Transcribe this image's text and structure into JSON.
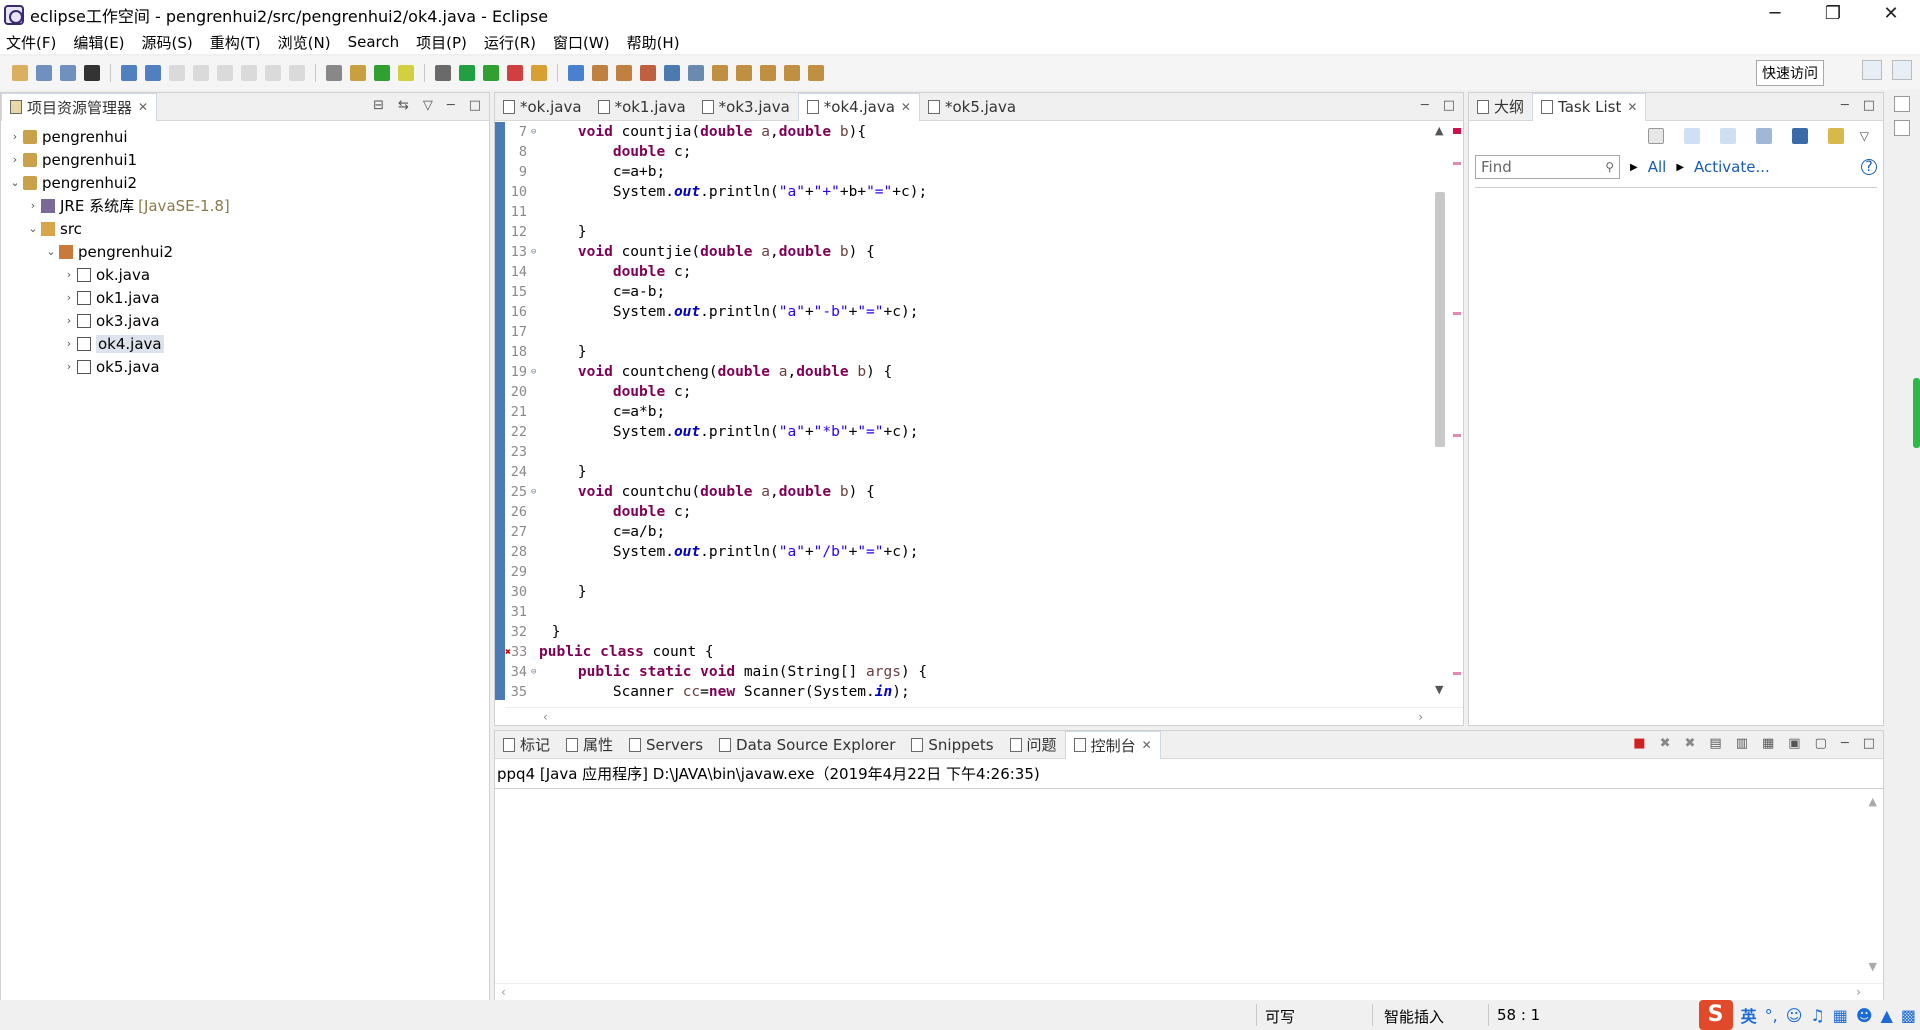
{
  "window": {
    "title": "eclipse工作空间 - pengrenhui2/src/pengrenhui2/ok4.java - Eclipse",
    "controls": [
      "─",
      "❐",
      "✕"
    ]
  },
  "menu": [
    "文件(F)",
    "编辑(E)",
    "源码(S)",
    "重构(T)",
    "浏览(N)",
    "Search",
    "项目(P)",
    "运行(R)",
    "窗口(W)",
    "帮助(H)"
  ],
  "toolbar": {
    "quick_access": "快速访问"
  },
  "explorer": {
    "title": "项目资源管理器",
    "items": [
      {
        "label": "pengrenhui",
        "level": 0,
        "expanded": false,
        "icon": "project-icon"
      },
      {
        "label": "pengrenhui1",
        "level": 0,
        "expanded": false,
        "icon": "project-icon"
      },
      {
        "label": "pengrenhui2",
        "level": 0,
        "expanded": true,
        "icon": "project-icon"
      },
      {
        "label": "JRE 系统库",
        "extra": "[JavaSE-1.8]",
        "level": 1,
        "expanded": false,
        "icon": "library-icon"
      },
      {
        "label": "src",
        "level": 1,
        "expanded": true,
        "icon": "source-folder-icon"
      },
      {
        "label": "pengrenhui2",
        "level": 2,
        "expanded": true,
        "icon": "package-icon"
      },
      {
        "label": "ok.java",
        "level": 3,
        "expanded": false,
        "icon": "java-file-icon"
      },
      {
        "label": "ok1.java",
        "level": 3,
        "expanded": false,
        "icon": "java-file-icon"
      },
      {
        "label": "ok3.java",
        "level": 3,
        "expanded": false,
        "icon": "java-file-icon"
      },
      {
        "label": "ok4.java",
        "level": 3,
        "expanded": false,
        "icon": "java-file-icon",
        "selected": true
      },
      {
        "label": "ok5.java",
        "level": 3,
        "expanded": false,
        "icon": "java-file-icon"
      }
    ]
  },
  "editor": {
    "tabs": [
      {
        "label": "*ok.java",
        "active": false
      },
      {
        "label": "*ok1.java",
        "active": false
      },
      {
        "label": "*ok3.java",
        "active": false
      },
      {
        "label": "*ok4.java",
        "active": true
      },
      {
        "label": "*ok5.java",
        "active": false
      }
    ],
    "lines": [
      {
        "n": "7",
        "fold": true,
        "code": [
          [
            "",
            "    "
          ],
          [
            "kw",
            "void"
          ],
          [
            "",
            " countjia("
          ],
          [
            "kw",
            "double"
          ],
          [
            "",
            " "
          ],
          [
            "prm",
            "a"
          ],
          [
            "",
            ","
          ],
          [
            "kw",
            "double"
          ],
          [
            "",
            " "
          ],
          [
            "prm",
            "b"
          ],
          [
            "",
            "){"
          ]
        ]
      },
      {
        "n": "8",
        "code": [
          [
            "",
            "        "
          ],
          [
            "kw",
            "double"
          ],
          [
            "",
            " c;"
          ]
        ]
      },
      {
        "n": "9",
        "code": [
          [
            "",
            "        c=a+b;"
          ]
        ]
      },
      {
        "n": "10",
        "code": [
          [
            "",
            "        System."
          ],
          [
            "fi",
            "out"
          ],
          [
            "",
            ".println("
          ],
          [
            "st",
            "\"a\""
          ],
          [
            "",
            "+"
          ],
          [
            "st",
            "\"+\""
          ],
          [
            "",
            "+b+"
          ],
          [
            "st",
            "\"=\""
          ],
          [
            "",
            "+c);"
          ]
        ]
      },
      {
        "n": "11",
        "code": [
          [
            "",
            ""
          ]
        ]
      },
      {
        "n": "12",
        "code": [
          [
            "",
            "    }"
          ]
        ]
      },
      {
        "n": "13",
        "fold": true,
        "code": [
          [
            "",
            "    "
          ],
          [
            "kw",
            "void"
          ],
          [
            "",
            " countjie("
          ],
          [
            "kw",
            "double"
          ],
          [
            "",
            " "
          ],
          [
            "prm",
            "a"
          ],
          [
            "",
            ","
          ],
          [
            "kw",
            "double"
          ],
          [
            "",
            " "
          ],
          [
            "prm",
            "b"
          ],
          [
            "",
            ") {"
          ]
        ]
      },
      {
        "n": "14",
        "code": [
          [
            "",
            "        "
          ],
          [
            "kw",
            "double"
          ],
          [
            "",
            " c;"
          ]
        ]
      },
      {
        "n": "15",
        "code": [
          [
            "",
            "        c=a-b;"
          ]
        ]
      },
      {
        "n": "16",
        "code": [
          [
            "",
            "        System."
          ],
          [
            "fi",
            "out"
          ],
          [
            "",
            ".println("
          ],
          [
            "st",
            "\"a\""
          ],
          [
            "",
            "+"
          ],
          [
            "st",
            "\"-b\""
          ],
          [
            "",
            "+"
          ],
          [
            "st",
            "\"=\""
          ],
          [
            "",
            "+c);"
          ]
        ]
      },
      {
        "n": "17",
        "code": [
          [
            "",
            ""
          ]
        ]
      },
      {
        "n": "18",
        "code": [
          [
            "",
            "    }"
          ]
        ]
      },
      {
        "n": "19",
        "fold": true,
        "code": [
          [
            "",
            "    "
          ],
          [
            "kw",
            "void"
          ],
          [
            "",
            " countcheng("
          ],
          [
            "kw",
            "double"
          ],
          [
            "",
            " "
          ],
          [
            "prm",
            "a"
          ],
          [
            "",
            ","
          ],
          [
            "kw",
            "double"
          ],
          [
            "",
            " "
          ],
          [
            "prm",
            "b"
          ],
          [
            "",
            ") {"
          ]
        ]
      },
      {
        "n": "20",
        "code": [
          [
            "",
            "        "
          ],
          [
            "kw",
            "double"
          ],
          [
            "",
            " c;"
          ]
        ]
      },
      {
        "n": "21",
        "code": [
          [
            "",
            "        c=a*b;"
          ]
        ]
      },
      {
        "n": "22",
        "code": [
          [
            "",
            "        System."
          ],
          [
            "fi",
            "out"
          ],
          [
            "",
            ".println("
          ],
          [
            "st",
            "\"a\""
          ],
          [
            "",
            "+"
          ],
          [
            "st",
            "\"*b\""
          ],
          [
            "",
            "+"
          ],
          [
            "st",
            "\"=\""
          ],
          [
            "",
            "+c);"
          ]
        ]
      },
      {
        "n": "23",
        "code": [
          [
            "",
            ""
          ]
        ]
      },
      {
        "n": "24",
        "code": [
          [
            "",
            "    }"
          ]
        ]
      },
      {
        "n": "25",
        "fold": true,
        "code": [
          [
            "",
            "    "
          ],
          [
            "kw",
            "void"
          ],
          [
            "",
            " countchu("
          ],
          [
            "kw",
            "double"
          ],
          [
            "",
            " "
          ],
          [
            "prm",
            "a"
          ],
          [
            "",
            ","
          ],
          [
            "kw",
            "double"
          ],
          [
            "",
            " "
          ],
          [
            "prm",
            "b"
          ],
          [
            "",
            ") {"
          ]
        ]
      },
      {
        "n": "26",
        "code": [
          [
            "",
            "        "
          ],
          [
            "kw",
            "double"
          ],
          [
            "",
            " c;"
          ]
        ]
      },
      {
        "n": "27",
        "code": [
          [
            "",
            "        c=a/b;"
          ]
        ]
      },
      {
        "n": "28",
        "code": [
          [
            "",
            "        System."
          ],
          [
            "fi",
            "out"
          ],
          [
            "",
            ".println("
          ],
          [
            "st",
            "\"a\""
          ],
          [
            "",
            "+"
          ],
          [
            "st",
            "\"/b\""
          ],
          [
            "",
            "+"
          ],
          [
            "st",
            "\"=\""
          ],
          [
            "",
            "+c);"
          ]
        ]
      },
      {
        "n": "29",
        "code": [
          [
            "",
            ""
          ]
        ]
      },
      {
        "n": "30",
        "code": [
          [
            "",
            "    }"
          ]
        ]
      },
      {
        "n": "31",
        "code": [
          [
            "",
            ""
          ]
        ]
      },
      {
        "n": "32",
        "code": [
          [
            "",
            " }"
          ]
        ]
      },
      {
        "n": "33",
        "error": true,
        "code": [
          [
            "kw",
            "public"
          ],
          [
            "",
            " "
          ],
          [
            "kw",
            "class"
          ],
          [
            "",
            " count {"
          ]
        ]
      },
      {
        "n": "34",
        "fold": true,
        "code": [
          [
            "",
            "    "
          ],
          [
            "kw",
            "public"
          ],
          [
            "",
            " "
          ],
          [
            "kw",
            "static"
          ],
          [
            "",
            " "
          ],
          [
            "kw",
            "void"
          ],
          [
            "",
            " main(String[] "
          ],
          [
            "prm",
            "args"
          ],
          [
            "",
            ") {"
          ]
        ]
      },
      {
        "n": "35",
        "code": [
          [
            "",
            "        Scanner "
          ],
          [
            "prm",
            "cc"
          ],
          [
            "",
            "="
          ],
          [
            "kw",
            "new"
          ],
          [
            "",
            " Scanner(System."
          ],
          [
            "fi",
            "in"
          ],
          [
            "",
            ");"
          ]
        ]
      }
    ]
  },
  "tasklist": {
    "tabs": [
      {
        "label": "大纲",
        "active": false
      },
      {
        "label": "Task List",
        "active": true
      }
    ],
    "find_placeholder": "Find",
    "all_label": "All",
    "activate_label": "Activate..."
  },
  "console": {
    "tabs": [
      {
        "label": "标记",
        "active": false
      },
      {
        "label": "属性",
        "active": false
      },
      {
        "label": "Servers",
        "active": false
      },
      {
        "label": "Data Source Explorer",
        "active": false
      },
      {
        "label": "Snippets",
        "active": false
      },
      {
        "label": "问题",
        "active": false
      },
      {
        "label": "控制台",
        "active": true
      }
    ],
    "header": "ppq4 [Java 应用程序] D:\\JAVA\\bin\\javaw.exe（2019年4月22日 下午4:26:35)"
  },
  "status": {
    "writable": "可写",
    "insert_mode": "智能插入",
    "position": "58 : 1"
  },
  "tray": {
    "ime": "英"
  }
}
